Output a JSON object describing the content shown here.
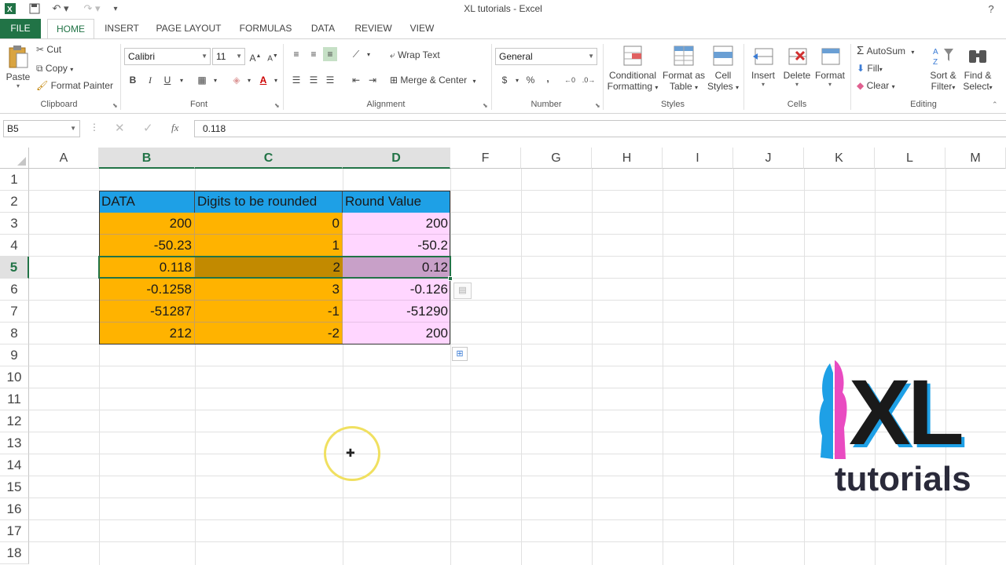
{
  "window": {
    "title": "XL tutorials - Excel"
  },
  "ribbon_tabs": [
    "FILE",
    "HOME",
    "INSERT",
    "PAGE LAYOUT",
    "FORMULAS",
    "DATA",
    "REVIEW",
    "VIEW"
  ],
  "clipboard": {
    "paste": "Paste",
    "cut": "Cut",
    "copy": "Copy",
    "format_painter": "Format Painter",
    "label": "Clipboard"
  },
  "font": {
    "name": "Calibri",
    "size": "11",
    "bold": "B",
    "italic": "I",
    "underline": "U",
    "label": "Font"
  },
  "alignment": {
    "wrap_text": "Wrap Text",
    "merge_center": "Merge & Center",
    "label": "Alignment"
  },
  "number": {
    "format": "General",
    "currency": "$",
    "percent": "%",
    "comma": ",",
    "label": "Number"
  },
  "styles": {
    "conditional": "Conditional",
    "conditional2": "Formatting",
    "format_as": "Format as",
    "format_as2": "Table",
    "cell": "Cell",
    "cell2": "Styles",
    "label": "Styles"
  },
  "cells": {
    "insert": "Insert",
    "delete": "Delete",
    "format": "Format",
    "label": "Cells"
  },
  "editing": {
    "autosum": "AutoSum",
    "fill": "Fill",
    "clear": "Clear",
    "sort": "Sort &",
    "sort2": "Filter",
    "find": "Find &",
    "find2": "Select",
    "label": "Editing"
  },
  "formula_bar": {
    "name_box": "B5",
    "fx": "fx",
    "value": "0.118"
  },
  "columns": [
    "A",
    "B",
    "C",
    "D",
    "F",
    "G",
    "H",
    "I",
    "J",
    "K",
    "L",
    "M"
  ],
  "rows": [
    "1",
    "2",
    "3",
    "4",
    "5",
    "6",
    "7",
    "8",
    "9",
    "10",
    "11",
    "12",
    "13",
    "14",
    "15",
    "16",
    "17",
    "18"
  ],
  "table": {
    "headers": [
      "DATA",
      "Digits to be rounded",
      "Round Value"
    ],
    "rows": [
      [
        "200",
        "0",
        "200"
      ],
      [
        "-50.23",
        "1",
        "-50.2"
      ],
      [
        "0.118",
        "2",
        "0.12"
      ],
      [
        "-0.1258",
        "3",
        "-0.126"
      ],
      [
        "-51287",
        "-1",
        "-51290"
      ],
      [
        "212",
        "-2",
        "200"
      ]
    ]
  },
  "logo": {
    "big": "XL",
    "small": "tutorials"
  },
  "colors": {
    "accent": "#217346",
    "header_fill": "#1ea0e6",
    "data_fill": "#ffb300",
    "result_fill": "#ffd6ff"
  }
}
